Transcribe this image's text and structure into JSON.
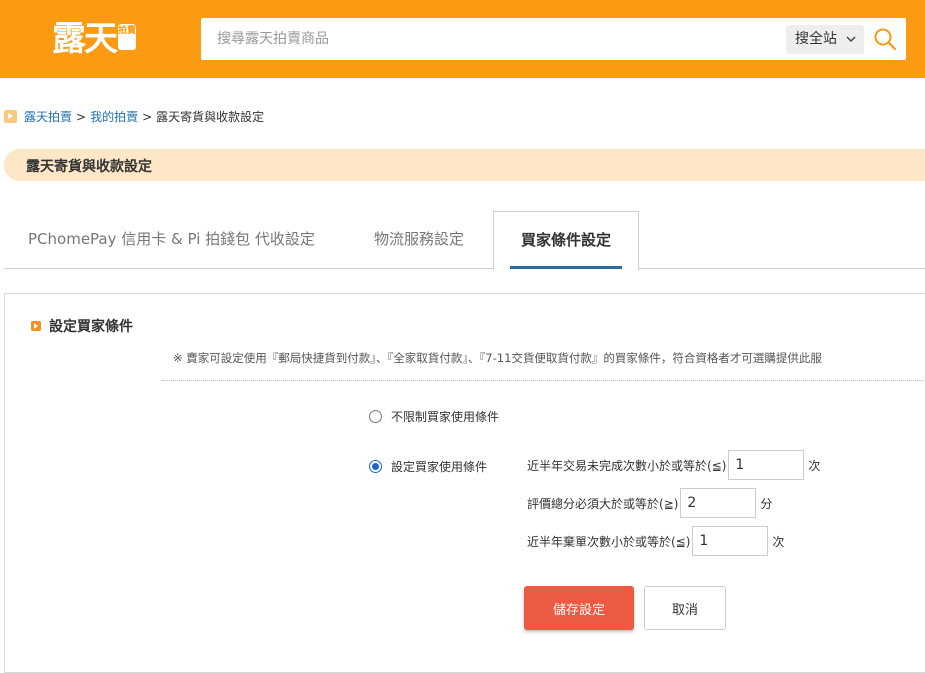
{
  "header": {
    "logo_text": "露天",
    "logo_badge": "拍賣",
    "search_placeholder": "搜尋露天拍賣商品",
    "search_scope": "搜全站",
    "brand_color": "#fb9a13"
  },
  "breadcrumb": {
    "items": [
      "露天拍賣",
      "我的拍賣"
    ],
    "separator": ">",
    "current": "露天寄貨與收款設定"
  },
  "page_title": "露天寄貨與收款設定",
  "tabs": [
    {
      "label": "PChomePay 信用卡 & Pi 拍錢包 代收設定",
      "active": false
    },
    {
      "label": "物流服務設定",
      "active": false
    },
    {
      "label": "買家條件設定",
      "active": true
    }
  ],
  "section": {
    "title": "設定買家條件",
    "note": "※ 賣家可設定使用『郵局快捷貨到付款』、『全家取貨付款』、『7-11交貨便取貨付款』的買家條件，符合資格者才可選購提供此服"
  },
  "options": {
    "unrestricted_label": "不限制買家使用條件",
    "restricted_label": "設定買家使用條件",
    "selected": "restricted"
  },
  "conditions": [
    {
      "label": "近半年交易未完成次數小於或等於(≦)",
      "value": "1",
      "unit": "次"
    },
    {
      "label": "評價總分必須大於或等於(≧)",
      "value": "2",
      "unit": "分"
    },
    {
      "label": "近半年棄單次數小於或等於(≦)",
      "value": "1",
      "unit": "次"
    }
  ],
  "buttons": {
    "save": "儲存設定",
    "cancel": "取消"
  },
  "icons": {
    "search": "search-icon",
    "chevron": "chevron-down-icon",
    "breadcrumb": "play-arrow-icon",
    "section": "play-arrow-icon"
  }
}
